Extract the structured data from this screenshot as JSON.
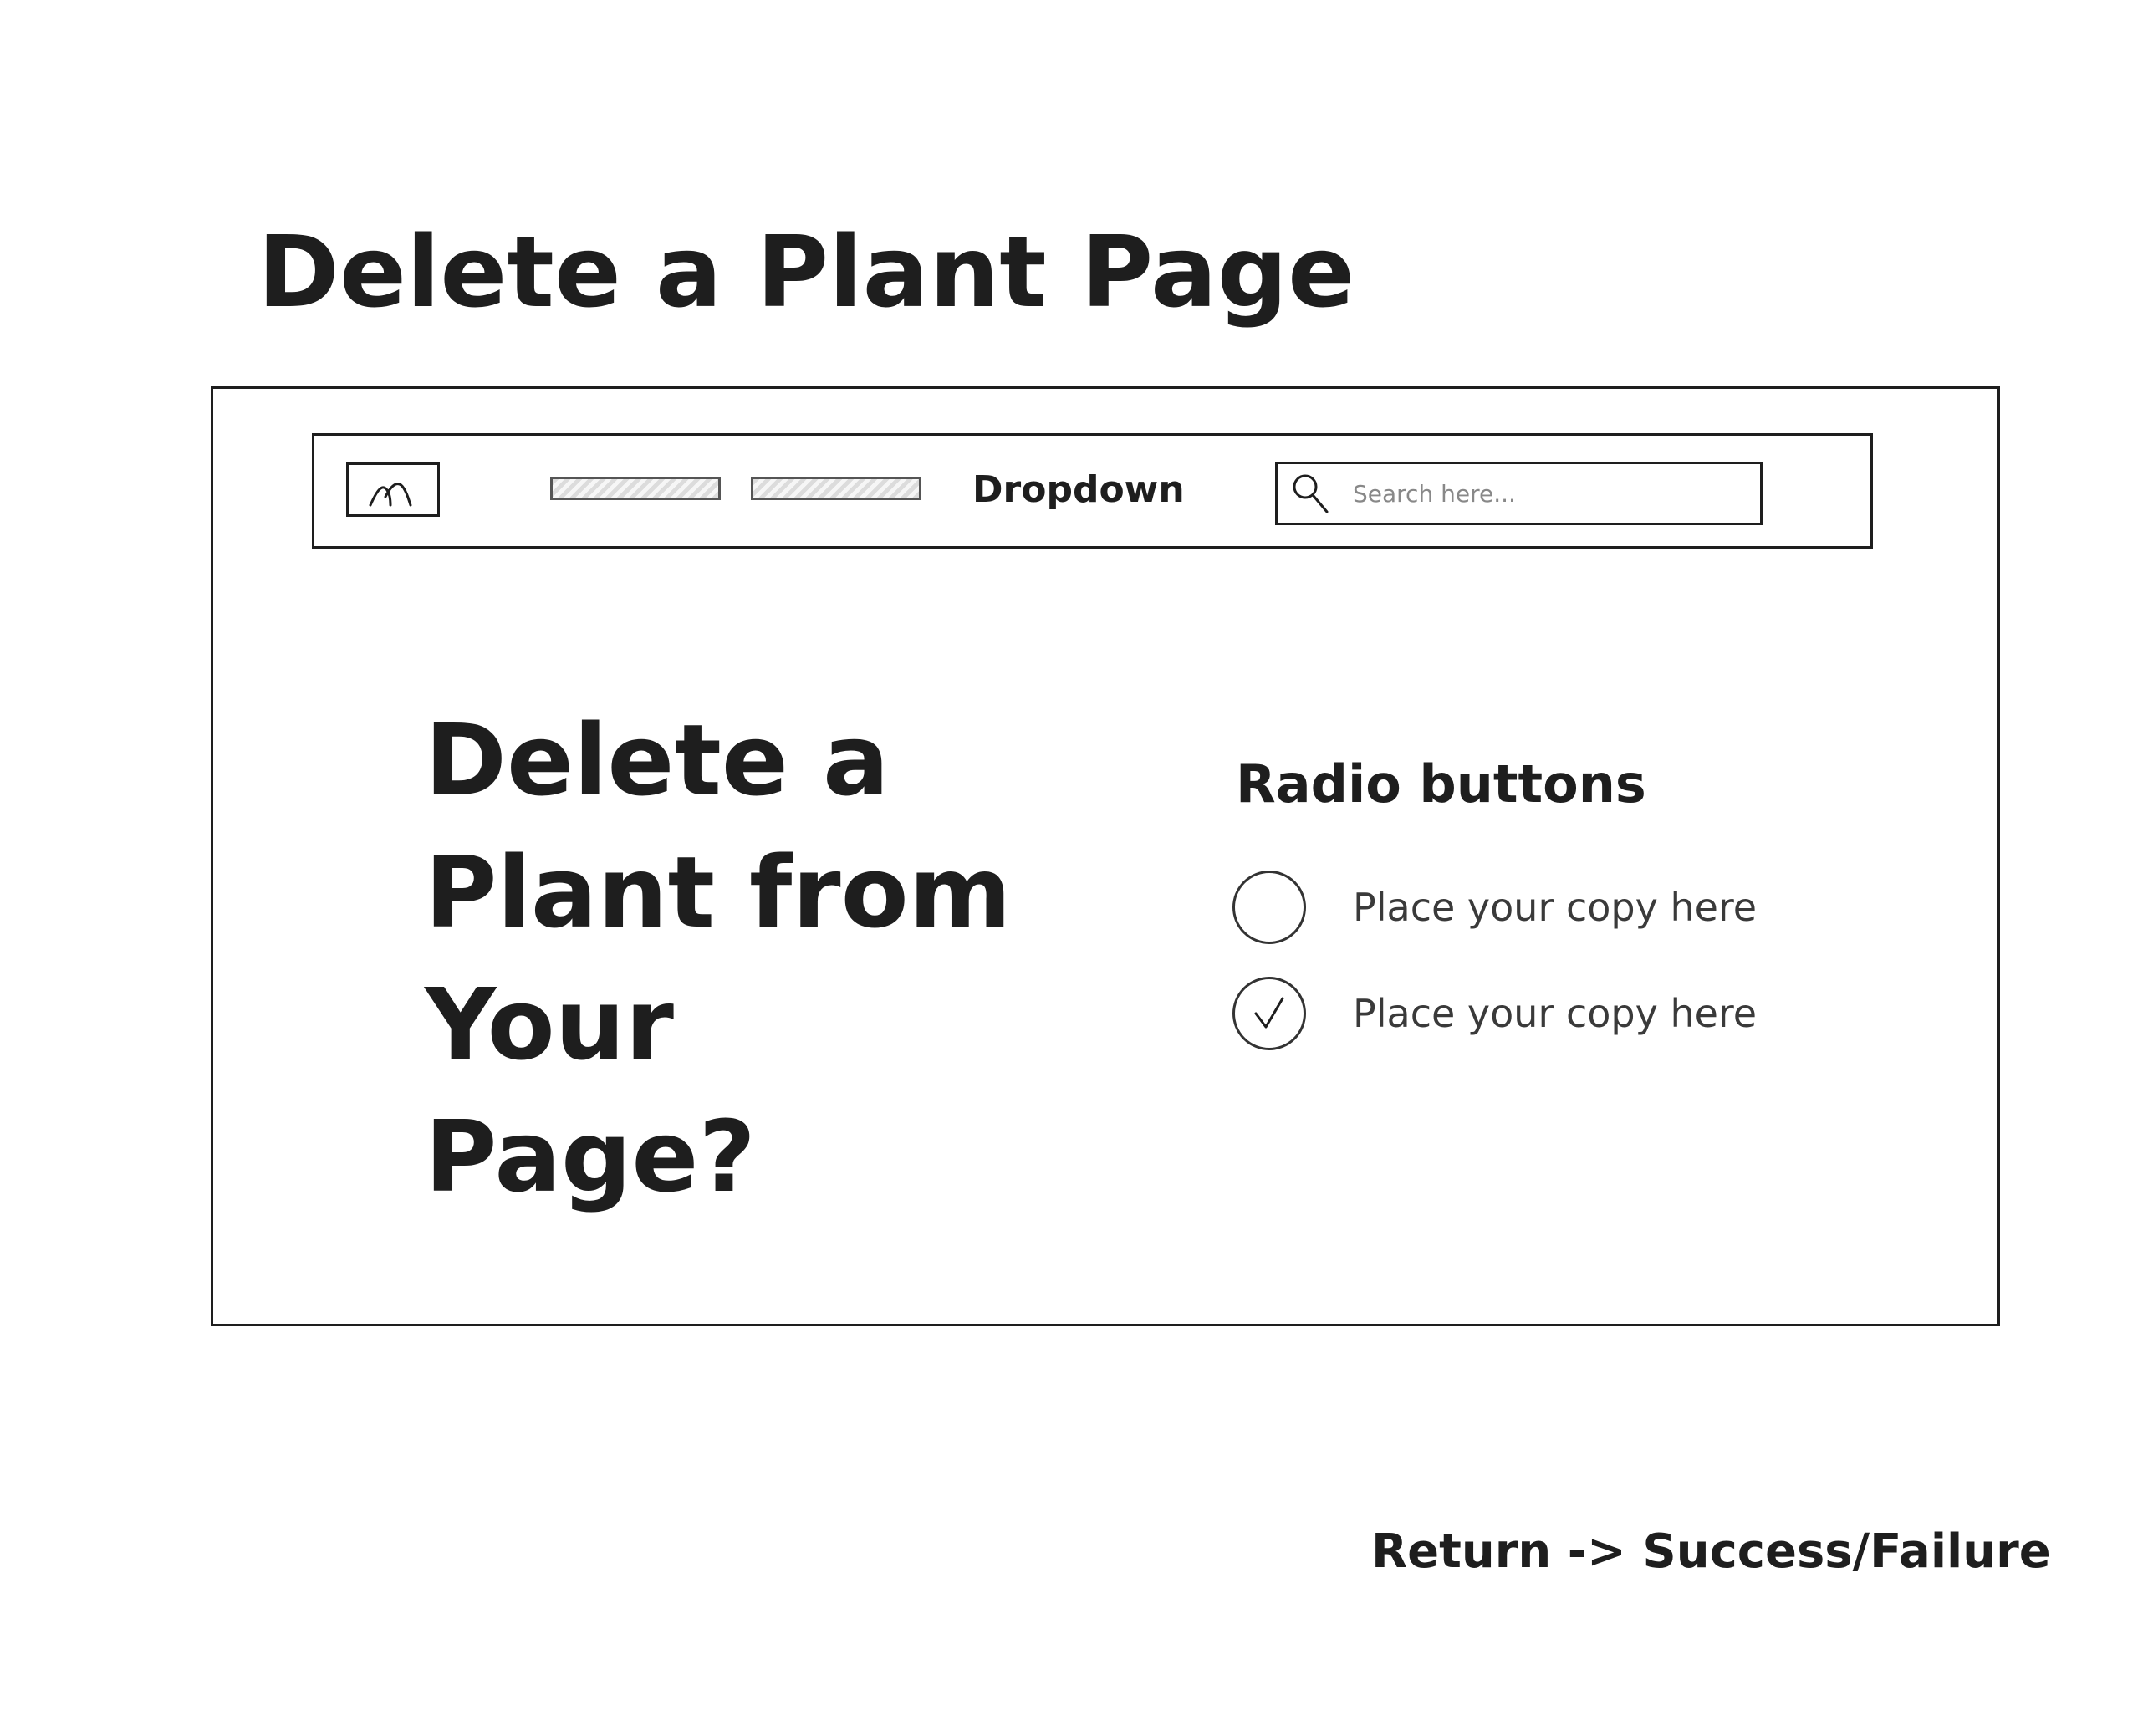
{
  "page_title": "Delete a Plant Page",
  "navbar": {
    "logo_icon": "image-placeholder-icon",
    "dropdown_label": "Dropdown",
    "search": {
      "icon": "search-icon",
      "placeholder": "Search here..."
    }
  },
  "main": {
    "heading": "Delete a Plant from Your Page?",
    "radio_group": {
      "title": "Radio buttons",
      "options": [
        {
          "label": "Place your copy here",
          "checked": false
        },
        {
          "label": "Place your copy here",
          "checked": true
        }
      ]
    }
  },
  "footnote": "Return -> Success/Failure"
}
